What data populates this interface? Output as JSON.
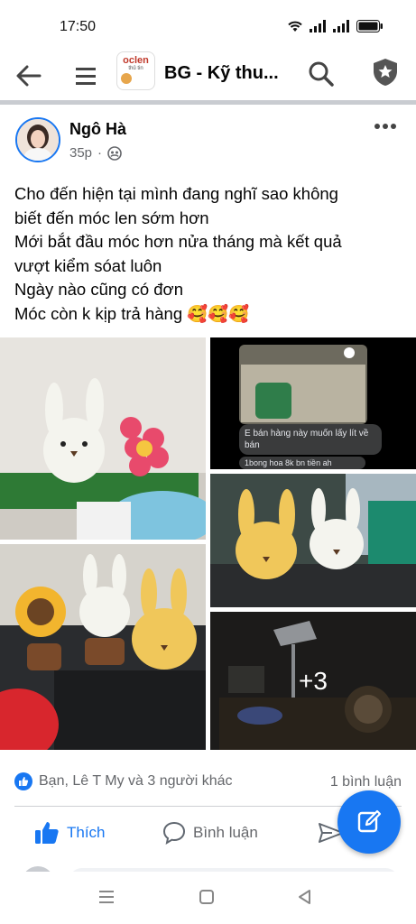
{
  "status_bar": {
    "time": "17:50",
    "icons": [
      "wifi-icon",
      "signal-icon",
      "signal-icon",
      "battery-icon"
    ]
  },
  "app_bar": {
    "group_title": "BG - Kỹ thu...",
    "group_logo_text": "oclen",
    "group_logo_subtext": "thủ tin",
    "icons": [
      "back-arrow-icon",
      "menu-icon",
      "search-icon",
      "shield-star-icon"
    ]
  },
  "post": {
    "author": "Ngô Hà",
    "time": "35p",
    "audience_icon": "group-audience-icon",
    "more_icon": "more-dots-icon",
    "text_lines": [
      "Cho đến hiện tại mình đang nghĩ sao không",
      "biết đến móc len sớm hơn",
      "Mới bắt đầu móc hơn nửa tháng mà kết quả",
      "vượt kiểm sóat luôn",
      "Ngày nào cũng có đơn",
      "Móc còn k kịp trả hàng 🥰🥰🥰"
    ],
    "photos": {
      "chat_message": "E bán hàng này muốn lấy lít về bán",
      "chat_message_2": "1bong hoa 8k bn tiền ah",
      "more_count": "+3"
    },
    "reactions_text": "Bạn, Lê T My và 3 người khác",
    "comment_count": "1 bình luận",
    "actions": {
      "like": "Thích",
      "comment": "Bình luận"
    }
  },
  "colors": {
    "accent": "#1877f2",
    "muted_text": "#65676b",
    "divider": "#c9ccd1",
    "crochet_yellow": "#f0c75a",
    "crochet_white": "#f4f4ee",
    "flower_pink": "#e84a6c",
    "yarn_blue": "#7ec4df",
    "yarn_red": "#d8262d"
  },
  "nav_bar": {
    "icons": [
      "recent-apps-icon",
      "home-icon",
      "back-triangle-icon"
    ]
  }
}
